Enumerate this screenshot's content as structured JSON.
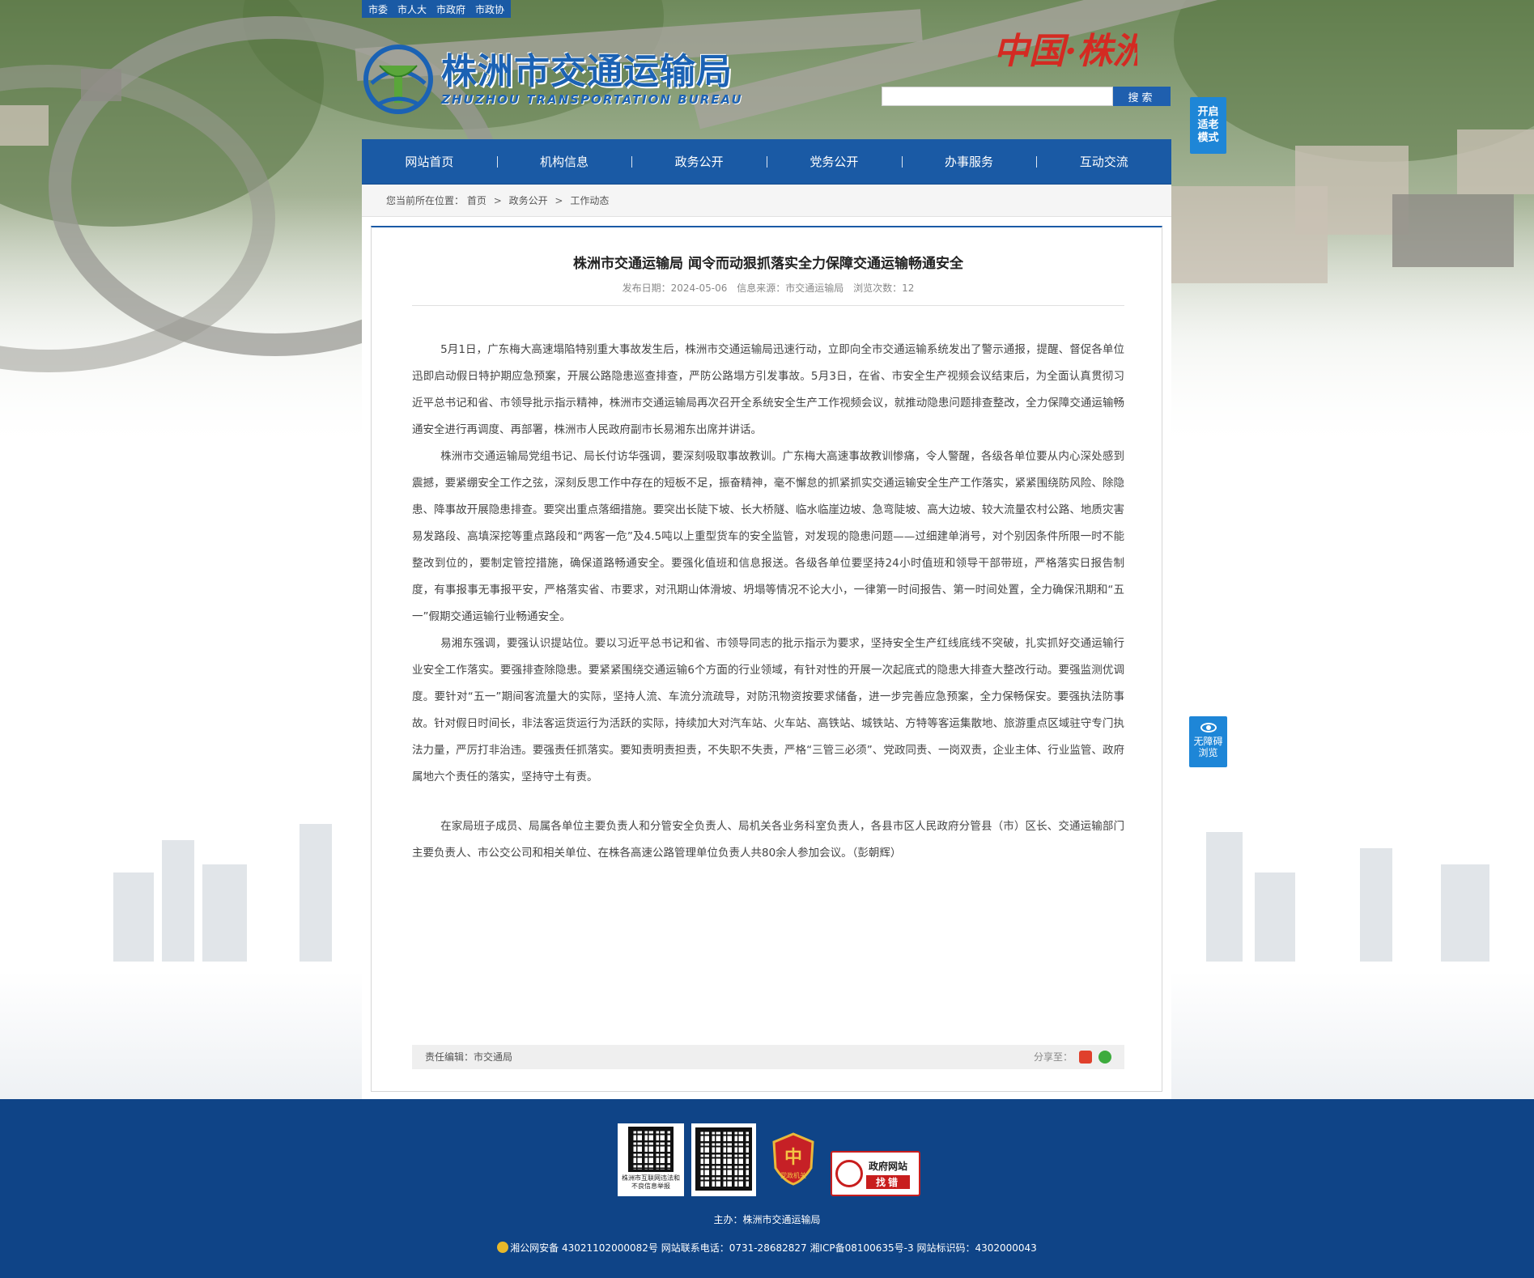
{
  "top_links": [
    "市委",
    "市人大",
    "市政府",
    "市政协"
  ],
  "logo": {
    "cn": "株洲市交通运输局",
    "en": "ZHUZHOU TRANSPORTATION BUREAU",
    "calligraphy": "中国·株洲"
  },
  "search": {
    "placeholder": "",
    "button": "搜索"
  },
  "elder_mode": [
    "开启",
    "适老",
    "模式"
  ],
  "nav": [
    "网站首页",
    "机构信息",
    "政务公开",
    "党务公开",
    "办事服务",
    "互动交流"
  ],
  "breadcrumb": {
    "label": "您当前所在位置：",
    "items": [
      "首页",
      "政务公开",
      "工作动态"
    ]
  },
  "article": {
    "title": "株洲市交通运输局 闻令而动狠抓落实全力保障交通运输畅通安全",
    "meta": {
      "date": "发布日期：2024-05-06",
      "source": "信息来源：市交通运输局",
      "views": "浏览次数：12"
    },
    "paragraphs": [
      "5月1日，广东梅大高速塌陷特别重大事故发生后，株洲市交通运输局迅速行动，立即向全市交通运输系统发出了警示通报，提醒、督促各单位迅即启动假日特护期应急预案，开展公路隐患巡查排查，严防公路塌方引发事故。5月3日，在省、市安全生产视频会议结束后，为全面认真贯彻习近平总书记和省、市领导批示指示精神，株洲市交通运输局再次召开全系统安全生产工作视频会议，就推动隐患问题排查整改，全力保障交通运输畅通安全进行再调度、再部署，株洲市人民政府副市长易湘东出席并讲话。",
      "株洲市交通运输局党组书记、局长付访华强调，要深刻吸取事故教训。广东梅大高速事故教训惨痛，令人警醒，各级各单位要从内心深处感到震撼，要紧绷安全工作之弦，深刻反思工作中存在的短板不足，振奋精神，毫不懈怠的抓紧抓实交通运输安全生产工作落实，紧紧围绕防风险、除隐患、降事故开展隐患排查。要突出重点落细措施。要突出长陡下坡、长大桥隧、临水临崖边坡、急弯陡坡、高大边坡、较大流量农村公路、地质灾害易发路段、高填深挖等重点路段和“两客一危”及4.5吨以上重型货车的安全监管，对发现的隐患问题——过细建单消号，对个别因条件所限一时不能整改到位的，要制定管控措施，确保道路畅通安全。要强化值班和信息报送。各级各单位要坚持24小时值班和领导干部带班，严格落实日报告制度，有事报事无事报平安，严格落实省、市要求，对汛期山体滑坡、坍塌等情况不论大小，一律第一时间报告、第一时间处置，全力确保汛期和“五一”假期交通运输行业畅通安全。",
      "易湘东强调，要强认识提站位。要以习近平总书记和省、市领导同志的批示指示为要求，坚持安全生产红线底线不突破，扎实抓好交通运输行业安全工作落实。要强排查除隐患。要紧紧围绕交通运输6个方面的行业领域，有针对性的开展一次起底式的隐患大排查大整改行动。要强监测优调度。要针对“五一”期间客流量大的实际，坚持人流、车流分流疏导，对防汛物资按要求储备，进一步完善应急预案，全力保畅保安。要强执法防事故。针对假日时间长，非法客运货运行为活跃的实际，持续加大对汽车站、火车站、高铁站、城铁站、方特等客运集散地、旅游重点区域驻守专门执法力量，严厉打非治违。要强责任抓落实。要知责明责担责，不失职不失责，严格“三管三必须”、党政同责、一岗双责，企业主体、行业监管、政府属地六个责任的落实，坚持守土有责。",
      "在家局班子成员、局属各单位主要负责人和分管安全负责人、局机关各业务科室负责人，各县市区人民政府分管县（市）区长、交通运输部门主要负责人、市公交公司和相关单位、在株各高速公路管理单位负责人共80余人参加会议。（彭朝辉）"
    ],
    "editor": "责任编辑：市交通局",
    "share_label": "分享至："
  },
  "accessibility": [
    "无障碍",
    "浏览"
  ],
  "footer": {
    "qr1_label": "株洲市互联网违法和不良信息举报",
    "party_label": "党政机关",
    "gov_error_top": "政府网站",
    "gov_error_bottom": "找错",
    "host": "主办：株洲市交通运输局",
    "icp": "湘公网安备 43021102000082号  网站联系电话：0731-28682827  湘ICP备08100635号-3  网站标识码：4302000043"
  },
  "colors": {
    "brand_blue": "#1a5aa5",
    "footer_blue": "#0f4487",
    "side_tab_blue": "#1e86d7"
  }
}
